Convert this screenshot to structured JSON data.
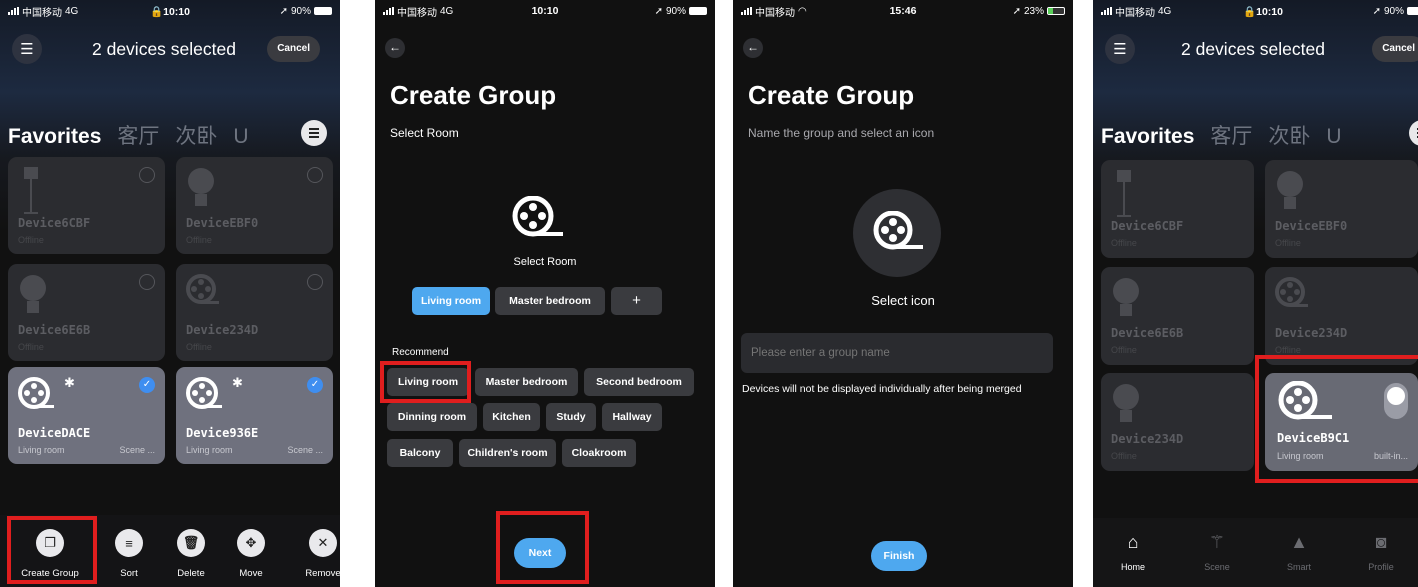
{
  "status": {
    "carrier": "中国移动",
    "net": "4G",
    "wifi_net": "中国移动",
    "time1": "10:10",
    "time2": "10:10",
    "time3": "15:46",
    "time4": "10:10",
    "battery1": "90%",
    "battery3": "23%"
  },
  "screen1": {
    "title": "2 devices selected",
    "cancel": "Cancel",
    "tabs": [
      "Favorites",
      "客厅",
      "次卧",
      "U"
    ],
    "devices": [
      {
        "name": "Device6CBF",
        "status": "Offline"
      },
      {
        "name": "DeviceEBF0",
        "status": "Offline"
      },
      {
        "name": "Device6E6B",
        "status": "Offline"
      },
      {
        "name": "Device234D",
        "status": "Offline"
      },
      {
        "name": "DeviceDACE",
        "status": "Living room",
        "scene": "Scene ..."
      },
      {
        "name": "Device936E",
        "status": "Living room",
        "scene": "Scene ..."
      }
    ],
    "toolbar": [
      "Create Group",
      "Sort",
      "Delete",
      "Move",
      "Remove"
    ],
    "colors": {
      "selected_card": "#6f717e",
      "check": "#3f8ef0",
      "highlight": "#e01e1e"
    }
  },
  "screen2": {
    "title": "Create Group",
    "subtitle": "Select Room",
    "icon_caption": "Select Room",
    "rooms": [
      "Living room",
      "Master bedroom",
      "+"
    ],
    "recommend_label": "Recommend",
    "recommend": [
      "Living room",
      "Master bedroom",
      "Second bedroom",
      "Dinning room",
      "Kitchen",
      "Study",
      "Hallway",
      "Balcony",
      "Children's room",
      "Cloakroom"
    ],
    "next": "Next",
    "colors": {
      "accent": "#4ea8ef"
    }
  },
  "screen3": {
    "title": "Create Group",
    "subtitle": "Name the group and select an icon",
    "icon_caption": "Select icon",
    "name_placeholder": "Please enter a group name",
    "note": "Devices will not be displayed individually after being merged",
    "finish": "Finish"
  },
  "screen4": {
    "title": "2 devices selected",
    "cancel": "Cancel",
    "tabs": [
      "Favorites",
      "客厅",
      "次卧",
      "U"
    ],
    "devices": [
      {
        "name": "Device6CBF",
        "status": "Offline"
      },
      {
        "name": "DeviceEBF0",
        "status": "Offline"
      },
      {
        "name": "Device6E6B",
        "status": "Offline"
      },
      {
        "name": "Device234D",
        "status": "Offline"
      },
      {
        "name": "Device234D",
        "status": "Offline"
      },
      {
        "name": "DeviceB9C1",
        "status": "Living room",
        "scene": "built-in..."
      }
    ],
    "nav": [
      "Home",
      "Scene",
      "Smart",
      "Profile"
    ]
  }
}
